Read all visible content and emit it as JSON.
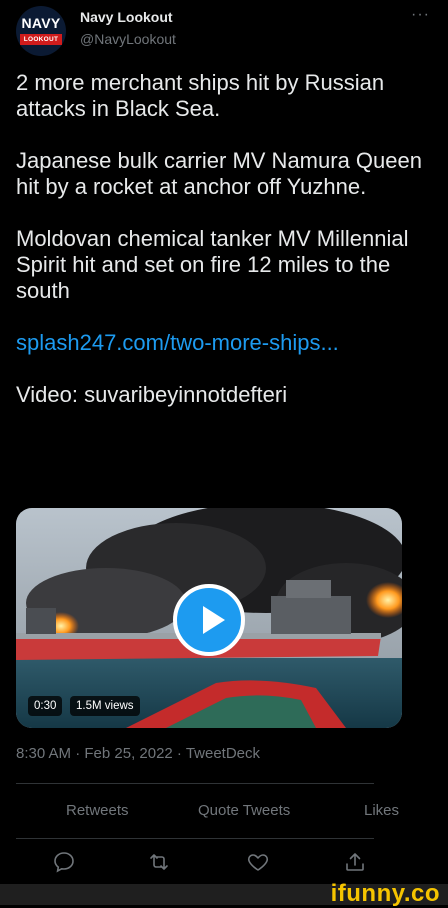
{
  "author": {
    "display_name": "Navy Lookout",
    "handle": "@NavyLookout",
    "avatar_top_text": "NAVY",
    "avatar_bottom_text": "LOOKOUT"
  },
  "more_icon": "more-horizontal-icon",
  "tweet": {
    "paragraph_1": "2 more merchant ships hit by Russian attacks in Black Sea.",
    "paragraph_2": "Japanese bulk carrier MV Namura Queen hit by a rocket at anchor off Yuzhne.",
    "paragraph_3": "Moldovan chemical tanker MV Millennial Spirit hit and set on fire 12 miles to the south",
    "link": "splash247.com/two-more-ships...",
    "paragraph_5": "Video: suvaribeyinnotdefteri"
  },
  "media": {
    "duration": "0:30",
    "views": "1.5M views",
    "play_icon": "play-icon"
  },
  "timestamp": "8:30 AM · Feb 25, 2022 · TweetDeck",
  "stats": {
    "retweets_label": "Retweets",
    "quote_tweets_label": "Quote Tweets",
    "likes_label": "Likes"
  },
  "actions": [
    "reply-icon",
    "retweet-icon",
    "like-icon",
    "share-icon"
  ],
  "watermark": "ifunny.co",
  "colors": {
    "background": "#000000",
    "text": "#e7e9ea",
    "secondary": "#71767b",
    "link": "#1d9bf0",
    "watermark": "#f5c400"
  }
}
